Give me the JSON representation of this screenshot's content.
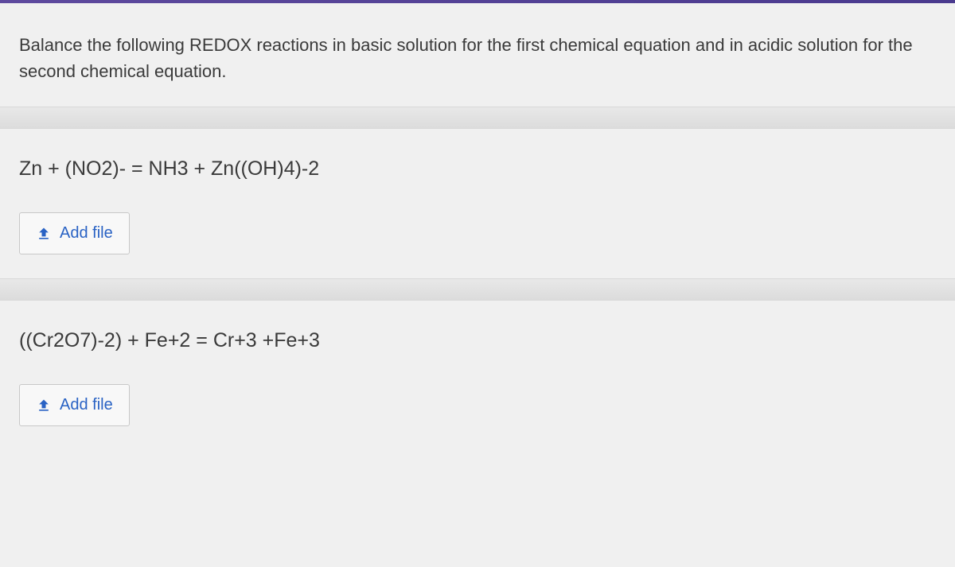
{
  "instruction": "Balance the following REDOX reactions in basic solution for the first chemical equation and in acidic solution for the second chemical equation.",
  "questions": [
    {
      "equation": "Zn + (NO2)- = NH3 + Zn((OH)4)-2",
      "button_label": "Add file"
    },
    {
      "equation": "((Cr2O7)-2) + Fe+2 = Cr+3 +Fe+3",
      "button_label": "Add file"
    }
  ]
}
